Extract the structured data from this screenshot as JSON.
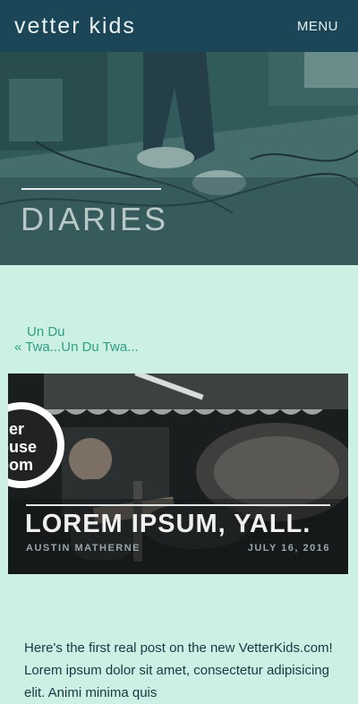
{
  "header": {
    "brand": "vetter kids",
    "menu_label": "MENU"
  },
  "hero": {
    "title": "DIARIES"
  },
  "post_nav": {
    "prev_line1": "Un Du",
    "prev_line2": "« Twa...Un Du Twa..."
  },
  "feature": {
    "title": "LOREM IPSUM, YALL.",
    "author": "AUSTIN MATHERNE",
    "date": "JULY 16, 2016"
  },
  "article": {
    "intro": "Here's the first real post on the new VetterKids.com! Lorem ipsum dolor sit amet, consectetur adipisicing elit. Animi minima quis"
  },
  "colors": {
    "header_bg": "#1b4657",
    "page_bg": "#cdf0e4",
    "link": "#2e9f7f",
    "body_text": "#163a43"
  }
}
